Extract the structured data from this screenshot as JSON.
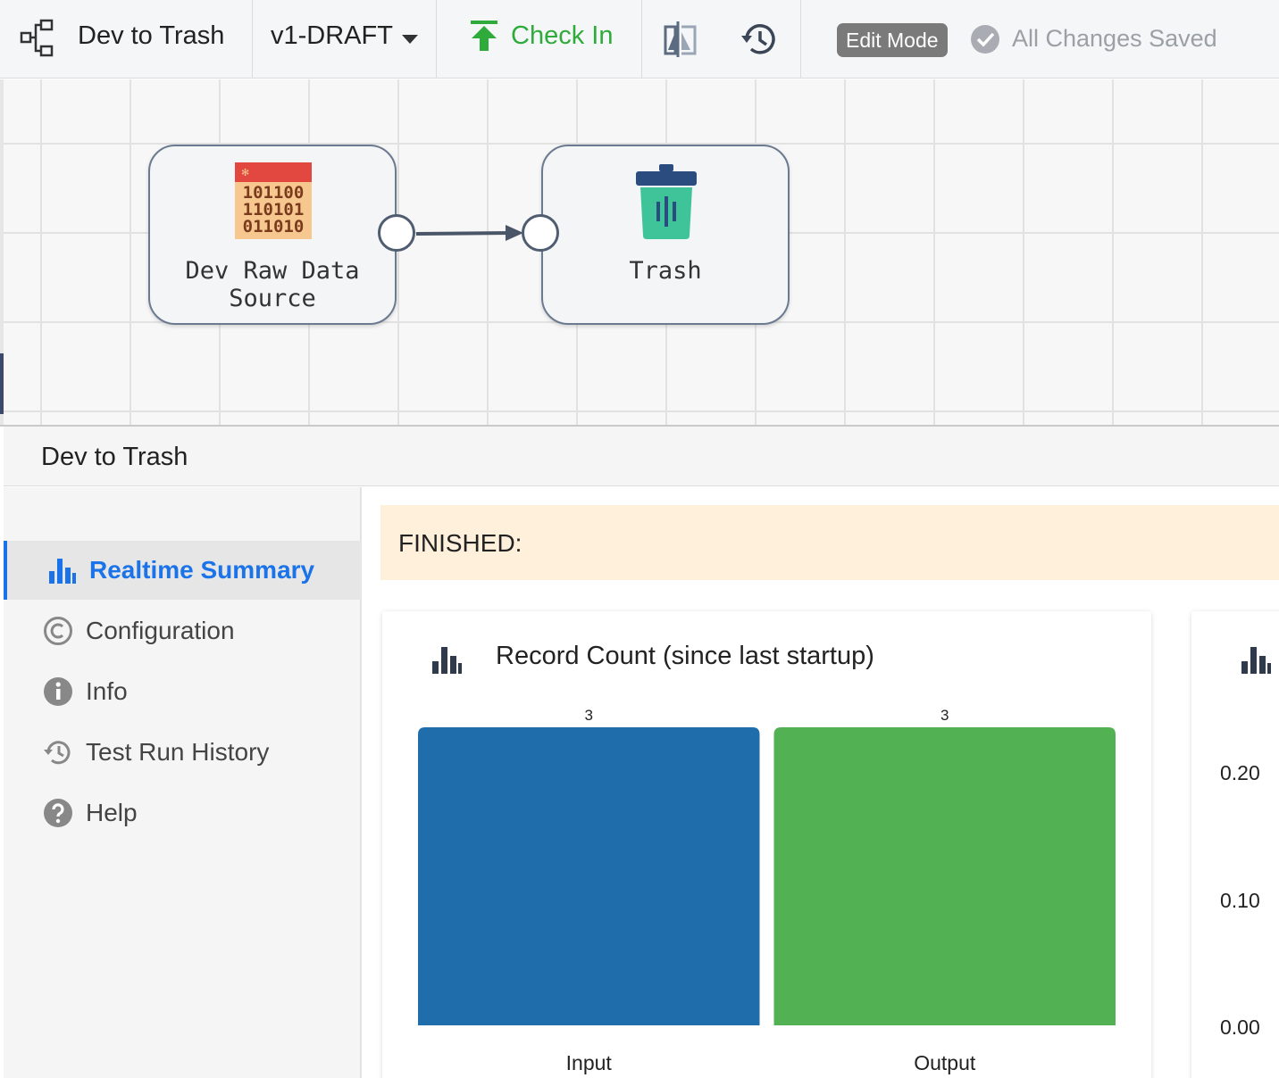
{
  "toolbar": {
    "pipeline_name": "Dev to Trash",
    "version": "v1-DRAFT",
    "check_in_label": "Check In",
    "edit_mode_label": "Edit Mode",
    "save_status": "All Changes Saved",
    "icons": [
      "pipeline-icon",
      "chevron-down-icon",
      "upload-arrow-icon",
      "compare-icon",
      "history-icon",
      "check-circle-icon"
    ]
  },
  "canvas": {
    "nodes": [
      {
        "label_line1": "Dev Raw Data",
        "label_line2": "Source",
        "icon": "binary-data-icon"
      },
      {
        "label_line1": "Trash",
        "label_line2": "",
        "icon": "trash-icon"
      }
    ]
  },
  "panel": {
    "title": "Dev to Trash",
    "nav": [
      {
        "label": "Realtime Summary",
        "icon": "bar-chart-icon",
        "active": true
      },
      {
        "label": "Configuration",
        "icon": "copyright-c-icon",
        "active": false
      },
      {
        "label": "Info",
        "icon": "info-icon",
        "active": false
      },
      {
        "label": "Test Run History",
        "icon": "history-icon",
        "active": false
      },
      {
        "label": "Help",
        "icon": "question-icon",
        "active": false
      }
    ],
    "status": "FINISHED:"
  },
  "colors": {
    "accent": "#1a73e8",
    "check_in": "#2eab3a",
    "input_bar": "#1f6dab",
    "output_bar": "#52b153",
    "status_bg": "#fff0dc"
  },
  "chart_data": [
    {
      "type": "bar",
      "title": "Record Count (since last startup)",
      "categories": [
        "Input",
        "Output"
      ],
      "values": [
        3,
        3
      ],
      "data_labels": [
        "3",
        "3"
      ],
      "colors": [
        "#1f6dab",
        "#52b153"
      ]
    },
    {
      "type": "bar",
      "title": "",
      "tick_labels": [
        "0.20",
        "0.10",
        "0.00"
      ]
    }
  ]
}
